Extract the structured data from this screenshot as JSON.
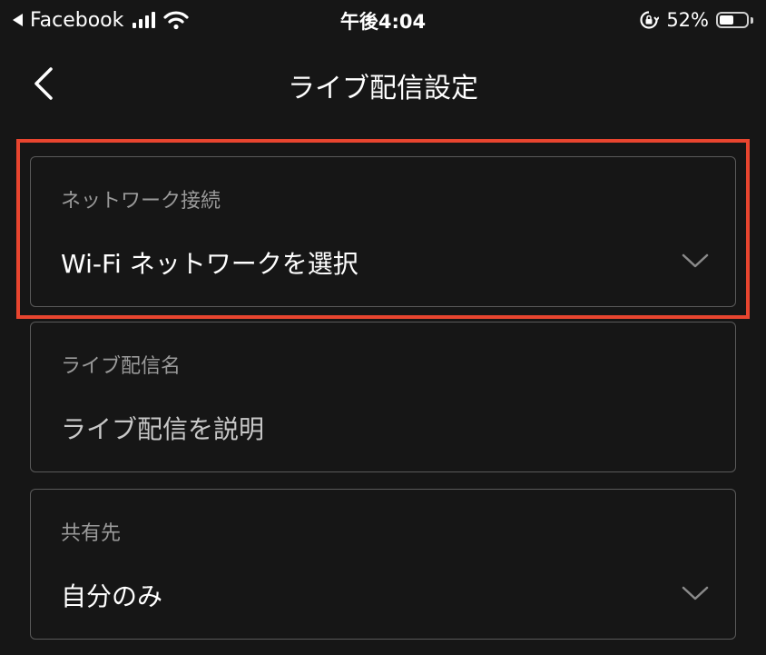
{
  "status_bar": {
    "back_app": "Facebook",
    "time": "午後4:04",
    "battery_percent": "52%",
    "battery_level": 0.52
  },
  "nav": {
    "title": "ライブ配信設定"
  },
  "fields": {
    "network": {
      "label": "ネットワーク接続",
      "value": "Wi-Fi ネットワークを選択"
    },
    "stream_name": {
      "label": "ライブ配信名",
      "placeholder": "ライブ配信を説明"
    },
    "share_to": {
      "label": "共有先",
      "value": "自分のみ"
    }
  },
  "colors": {
    "background": "#161616",
    "highlight": "#e8452f",
    "border": "#5a5a5a"
  }
}
